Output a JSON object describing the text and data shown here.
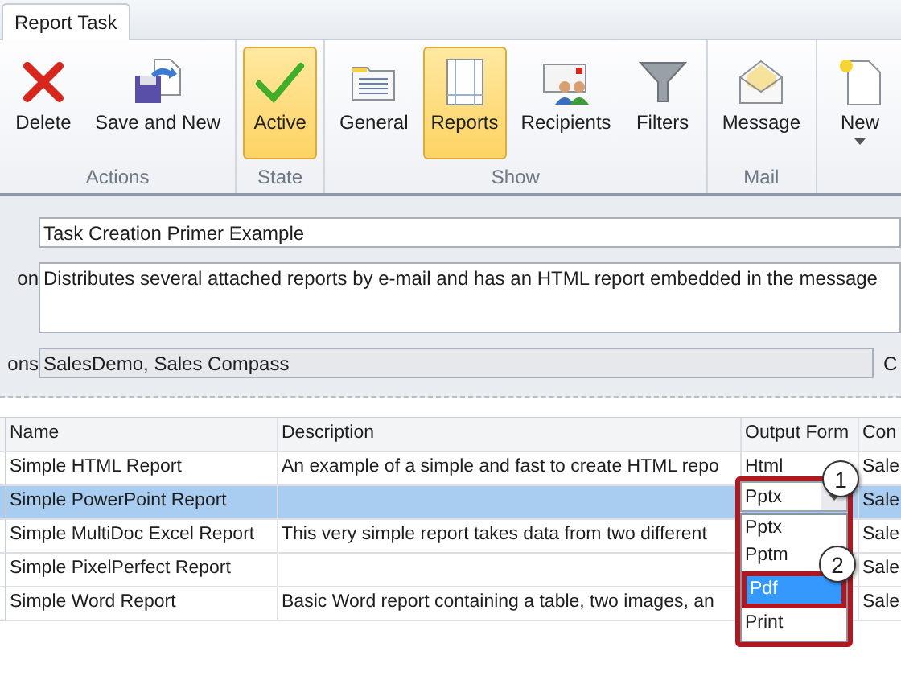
{
  "tabs": [
    {
      "label": "Report Task",
      "selected": true
    }
  ],
  "ribbon": [
    {
      "label": "Actions",
      "buttons": [
        {
          "label": "Delete",
          "kind": "delete",
          "selected": false
        },
        {
          "label": "Save and New",
          "kind": "save",
          "selected": false
        }
      ]
    },
    {
      "label": "State",
      "buttons": [
        {
          "label": "Active",
          "kind": "check",
          "selected": true
        }
      ]
    },
    {
      "label": "Show",
      "buttons": [
        {
          "label": "General",
          "kind": "general",
          "selected": false
        },
        {
          "label": "Reports",
          "kind": "reports",
          "selected": true
        },
        {
          "label": "Recipients",
          "kind": "recipients",
          "selected": false
        },
        {
          "label": "Filters",
          "kind": "filter",
          "selected": false
        }
      ]
    },
    {
      "label": "Mail",
      "buttons": [
        {
          "label": "Message",
          "kind": "message",
          "selected": false
        }
      ]
    },
    {
      "buttons": [
        {
          "label": "New",
          "kind": "new",
          "selected": false,
          "dropdown": true
        }
      ]
    }
  ],
  "form": [
    {
      "value": "Task Creation Primer Example",
      "kind": "text"
    },
    {
      "label": "on",
      "value": "Distributes several attached reports by e-mail and has an HTML report embedded in the message",
      "kind": "area"
    },
    {
      "label": "ons",
      "value": "SalesDemo, Sales Compass",
      "kind": "readonly",
      "after": "C"
    }
  ],
  "table": {
    "columns": [
      "Name",
      "Description",
      "Output Form",
      "Con"
    ],
    "rows": [
      {
        "name": "Simple HTML Report",
        "description": "An example of a simple and fast to create HTML repo",
        "output": "Html",
        "connection": "Sale",
        "selected": false
      },
      {
        "name": "Simple PowerPoint Report",
        "output": "Pptx",
        "connection": "Sale",
        "selected": true,
        "editing": true
      },
      {
        "name": "Simple MultiDoc Excel Report",
        "description": "This very simple report takes data from two different",
        "connection": "Sale",
        "selected": false
      },
      {
        "name": "Simple PixelPerfect Report",
        "connection": "Sale",
        "selected": false
      },
      {
        "name": "Simple Word Report",
        "description": "Basic Word report containing a table, two images, an",
        "connection": "Sale",
        "selected": false
      }
    ]
  },
  "dropdown": {
    "options": [
      {
        "label": "Pptx",
        "selected": false
      },
      {
        "label": "Pptm",
        "selected": false
      },
      {
        "label": "Pdf",
        "selected": true
      },
      {
        "label": "Print",
        "selected": false
      }
    ]
  },
  "annotations": [
    {
      "number": "1"
    },
    {
      "number": "2"
    }
  ]
}
